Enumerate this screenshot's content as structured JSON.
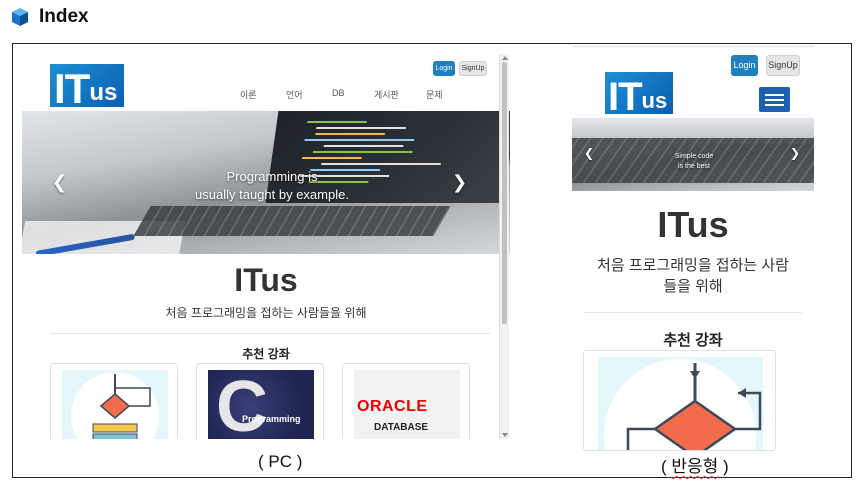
{
  "page": {
    "title": "Index",
    "icon": "cube-icon"
  },
  "colors": {
    "accent_blue": "#1f7fbf",
    "logo_blue": "#1d8fd6",
    "hamburger_blue": "#1e5faf",
    "oracle_red": "#ee0000"
  },
  "pc": {
    "caption": "( PC )",
    "logo": {
      "big": "IT",
      "small": "us"
    },
    "auth": {
      "login": "Login",
      "signup": "SignUp"
    },
    "nav": [
      "이론",
      "언어",
      "DB",
      "게시판",
      "문제"
    ],
    "hero": {
      "line1": "Programming is",
      "line2": "usually taught by example."
    },
    "site_title": "ITus",
    "site_subtitle": "처음 프로그래밍을 접하는 사람들을 위해",
    "section_title": "추천 강좌",
    "cards": [
      {
        "image": "flowchart"
      },
      {
        "image": "c-programming",
        "letter": "C",
        "label": "Programming"
      },
      {
        "image": "oracle-database",
        "brand": "ORACLE",
        "sub": "DATABASE"
      }
    ]
  },
  "mobile": {
    "caption_open": "( ",
    "caption_word": "반응형",
    "caption_close": " )",
    "logo": {
      "big": "IT",
      "small": "us"
    },
    "auth": {
      "login": "Login",
      "signup": "SignUp"
    },
    "hero": {
      "line1": "Simple code",
      "line2": "is the best"
    },
    "site_title": "ITus",
    "site_subtitle": "처음 프로그래밍을 접하는 사람들을 위해",
    "section_title": "추천 강좌",
    "menu_icon": "hamburger-icon"
  }
}
